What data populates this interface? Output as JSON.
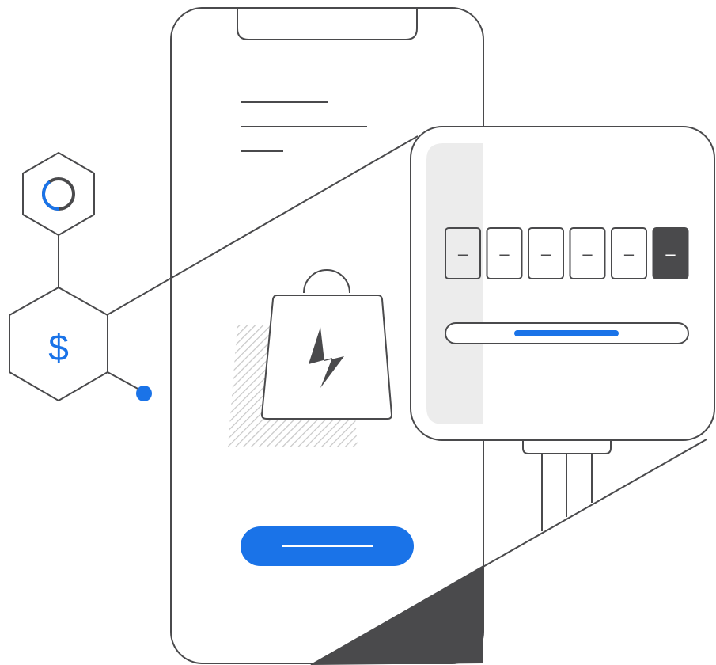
{
  "colors": {
    "line": "#4a4a4c",
    "accent": "#1a73e8",
    "panel_shade": "#ececec",
    "hatch": "#c8c8c8",
    "dark_fill": "#4a4a4c",
    "background": "#ffffff"
  },
  "icons": {
    "currency": "dollar-sign-icon",
    "loading": "loading-ring-icon",
    "product": "shopping-bag-lightning-icon"
  },
  "currency_symbol": "$",
  "code_input": {
    "digits": [
      "–",
      "–",
      "–",
      "–",
      "–",
      "–"
    ],
    "active_index": 5
  },
  "progress_fraction": 0.6,
  "loading_fraction": 0.6
}
